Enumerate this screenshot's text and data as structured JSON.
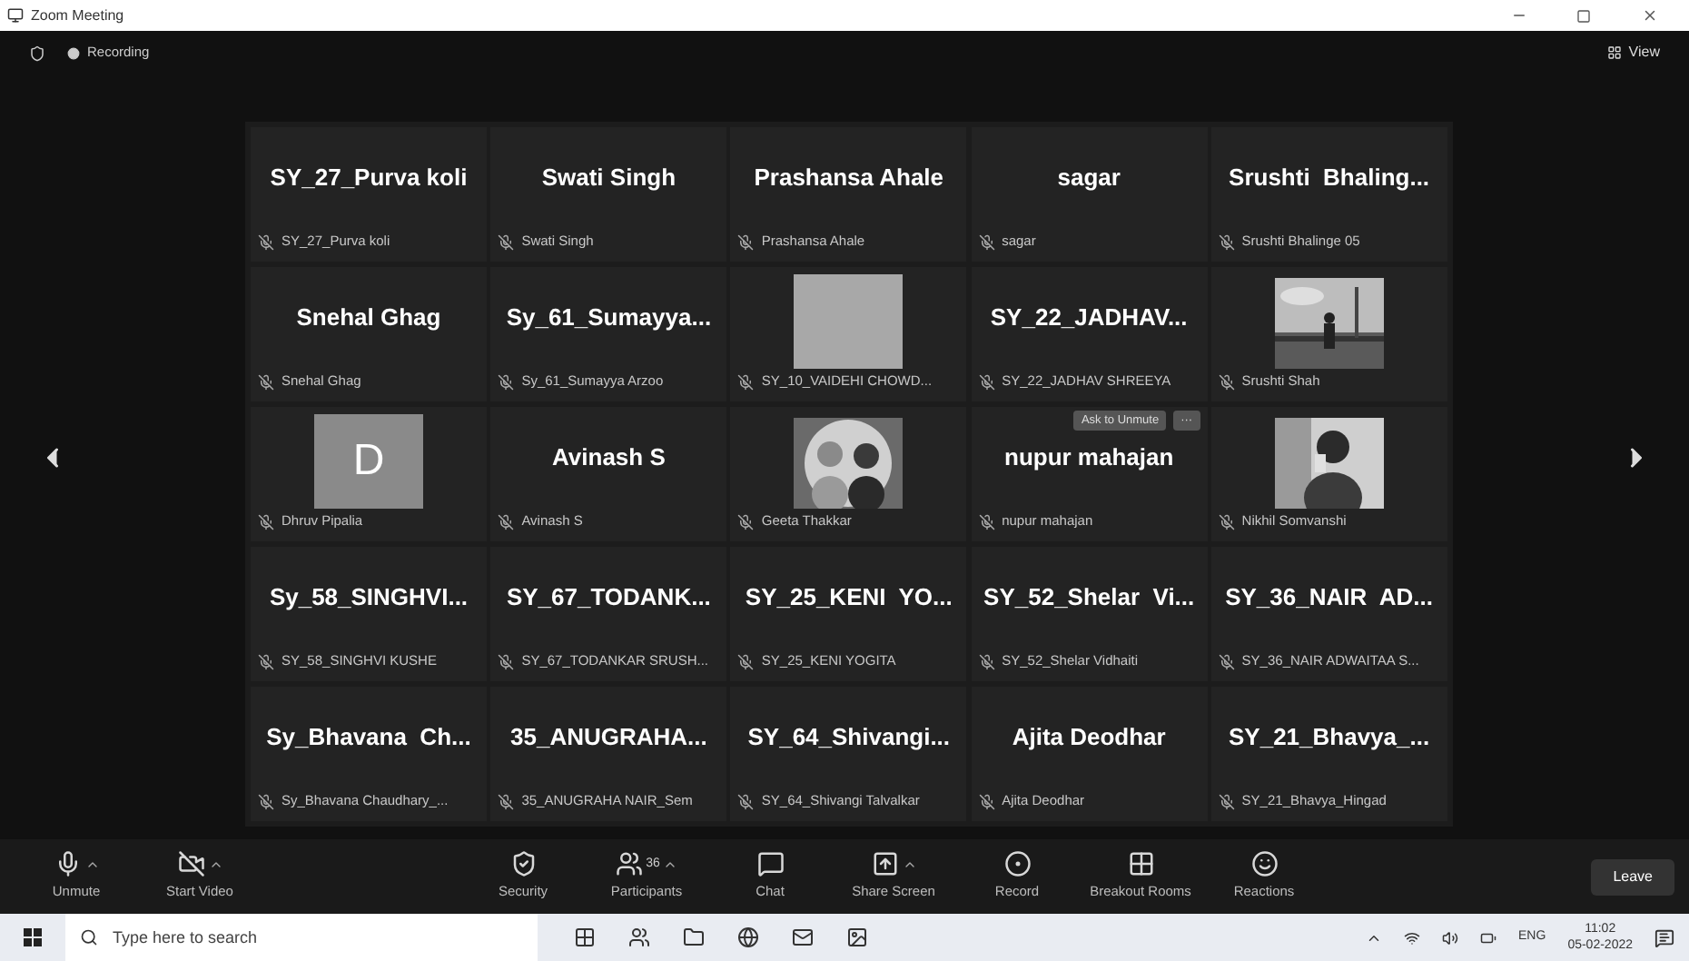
{
  "window": {
    "title": "Zoom Meeting"
  },
  "meeting_bar": {
    "recording": "Recording",
    "view": "View"
  },
  "tiles": [
    {
      "kind": "name",
      "title": "SY_27_Purva koli",
      "label": "SY_27_Purva koli"
    },
    {
      "kind": "name",
      "title": "Swati Singh",
      "label": "Swati Singh"
    },
    {
      "kind": "name",
      "title": "Prashansa Ahale",
      "label": "Prashansa Ahale"
    },
    {
      "kind": "name",
      "title": "sagar",
      "label": "sagar"
    },
    {
      "kind": "name",
      "title": "Srushti  Bhaling...",
      "label": "Srushti Bhalinge 05"
    },
    {
      "kind": "name",
      "title": "Snehal Ghag",
      "label": "Snehal Ghag"
    },
    {
      "kind": "name",
      "title": "Sy_61_Sumayya...",
      "label": "Sy_61_Sumayya Arzoo"
    },
    {
      "kind": "blank",
      "label": "SY_10_VAIDEHI CHOWD..."
    },
    {
      "kind": "name",
      "title": "SY_22_JADHAV...",
      "label": "SY_22_JADHAV SHREEYA"
    },
    {
      "kind": "picture",
      "label": "Srushti Shah"
    },
    {
      "kind": "avatar",
      "title": "D",
      "label": "Dhruv Pipalia"
    },
    {
      "kind": "name",
      "title": "Avinash S",
      "label": "Avinash S"
    },
    {
      "kind": "picture",
      "label": "Geeta Thakkar"
    },
    {
      "kind": "name",
      "title": "nupur mahajan",
      "label": "nupur mahajan",
      "hover": {
        "button": "Ask to Unmute",
        "more": "···"
      }
    },
    {
      "kind": "picture",
      "label": "Nikhil Somvanshi"
    },
    {
      "kind": "name",
      "title": "Sy_58_SINGHVI...",
      "label": "SY_58_SINGHVI KUSHE"
    },
    {
      "kind": "name",
      "title": "SY_67_TODANK...",
      "label": "SY_67_TODANKAR SRUSH..."
    },
    {
      "kind": "name",
      "title": "SY_25_KENI  YO...",
      "label": "SY_25_KENI YOGITA"
    },
    {
      "kind": "name",
      "title": "SY_52_Shelar  Vi...",
      "label": "SY_52_Shelar Vidhaiti"
    },
    {
      "kind": "name",
      "title": "SY_36_NAIR  AD...",
      "label": "SY_36_NAIR ADWAITAA S..."
    },
    {
      "kind": "name",
      "title": "Sy_Bhavana  Ch...",
      "label": "Sy_Bhavana Chaudhary_..."
    },
    {
      "kind": "name",
      "title": "35_ANUGRAHA...",
      "label": "35_ANUGRAHA NAIR_Sem"
    },
    {
      "kind": "name",
      "title": "SY_64_Shivangi...",
      "label": "SY_64_Shivangi Talvalkar"
    },
    {
      "kind": "name",
      "title": "Ajita Deodhar",
      "label": "Ajita Deodhar"
    },
    {
      "kind": "name",
      "title": "SY_21_Bhavya_...",
      "label": "SY_21_Bhavya_Hingad"
    }
  ],
  "toolbar": {
    "left": [
      {
        "label": "Unmute",
        "has_menu": true
      },
      {
        "label": "Start Video",
        "has_menu": true
      }
    ],
    "center": [
      {
        "label": "Security",
        "has_menu": false
      },
      {
        "label": "Participants",
        "has_menu": true,
        "count": "36"
      },
      {
        "label": "Chat",
        "has_menu": false
      },
      {
        "label": "Share Screen",
        "has_menu": true
      },
      {
        "label": "Record",
        "has_menu": false
      },
      {
        "label": "Breakout Rooms",
        "has_menu": false
      },
      {
        "label": "Reactions",
        "has_menu": false
      }
    ],
    "leave": "Leave"
  },
  "taskbar": {
    "search_placeholder": "Type here to search",
    "language": "ENG",
    "time": "11:02",
    "date": "05-02-2022"
  }
}
